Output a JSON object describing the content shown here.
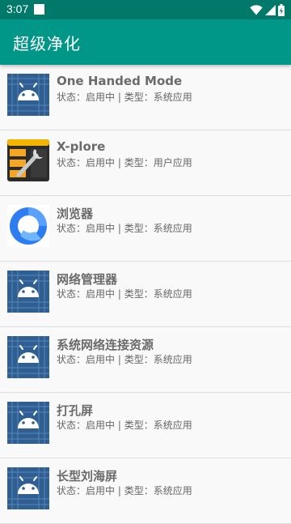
{
  "status_bar": {
    "time": "3:07",
    "icons": [
      "notification-square-icon",
      "wifi-icon",
      "signal-icon",
      "battery-charging-icon"
    ]
  },
  "app_bar": {
    "title": "超级净化",
    "background": "#009688"
  },
  "meta_labels": {
    "status_prefix": "状态：",
    "separator": " | ",
    "type_prefix": "类型："
  },
  "apps": [
    {
      "name": "One Handed Mode",
      "status": "启用中",
      "type": "系统应用",
      "icon": "android-default-icon"
    },
    {
      "name": "X-plore",
      "status": "启用中",
      "type": "用户应用",
      "icon": "xplore-icon"
    },
    {
      "name": "浏览器",
      "status": "启用中",
      "type": "系统应用",
      "icon": "browser-icon"
    },
    {
      "name": "网络管理器",
      "status": "启用中",
      "type": "系统应用",
      "icon": "android-default-icon"
    },
    {
      "name": "系统网络连接资源",
      "status": "启用中",
      "type": "系统应用",
      "icon": "android-default-icon"
    },
    {
      "name": "打孔屏",
      "status": "启用中",
      "type": "系统应用",
      "icon": "android-default-icon"
    },
    {
      "name": "长型刘海屏",
      "status": "启用中",
      "type": "系统应用",
      "icon": "android-default-icon"
    }
  ],
  "colors": {
    "status_bar": "#00796b",
    "app_bar": "#009688",
    "list_background": "#f9f9f9",
    "android_icon_blue": "#2f5f92"
  }
}
